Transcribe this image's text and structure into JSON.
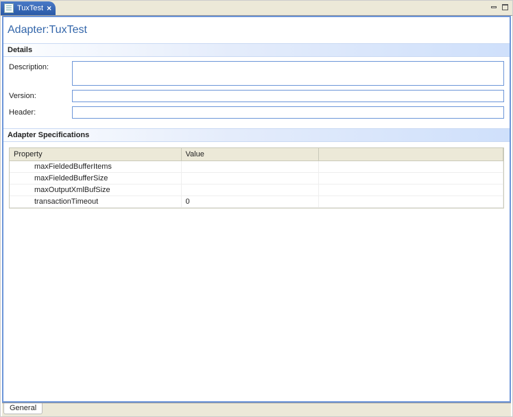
{
  "tab": {
    "label": "TuxTest"
  },
  "title": "Adapter:TuxTest",
  "sections": {
    "details": "Details",
    "specs": "Adapter Specifications"
  },
  "details": {
    "description_label": "Description:",
    "description_value": "",
    "version_label": "Version:",
    "version_value": "",
    "header_label": "Header:",
    "header_value": ""
  },
  "spec_table": {
    "columns": {
      "property": "Property",
      "value": "Value",
      "empty": ""
    },
    "rows": [
      {
        "property": "maxFieldedBufferItems",
        "value": ""
      },
      {
        "property": "maxFieldedBufferSize",
        "value": ""
      },
      {
        "property": "maxOutputXmlBufSize",
        "value": ""
      },
      {
        "property": "transactionTimeout",
        "value": "0"
      }
    ]
  },
  "bottom_tab": "General"
}
